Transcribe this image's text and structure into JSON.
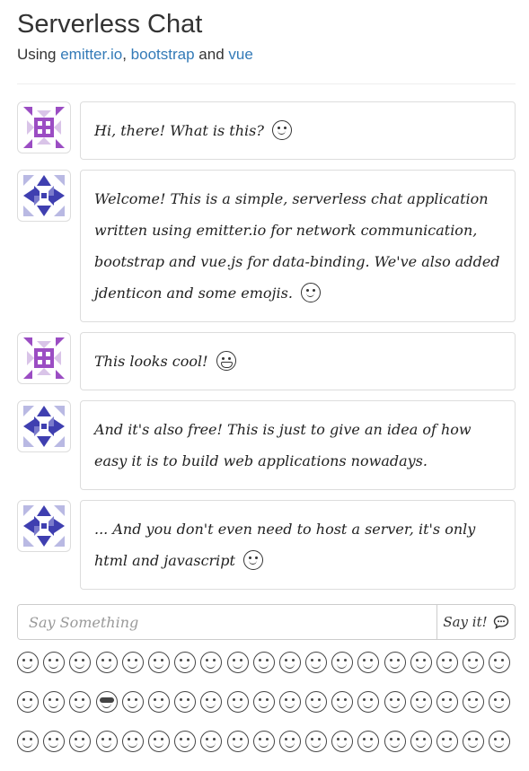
{
  "header": {
    "title": "Serverless Chat",
    "subtitle_prefix": "Using",
    "link1": "emitter.io",
    "sep1": ",",
    "link2": "bootstrap",
    "sep2": "and",
    "link3": "vue"
  },
  "messages": [
    {
      "avatar": "purple-identicon",
      "text": "Hi, there! What is this?",
      "emoji": "slightly-smiling-face"
    },
    {
      "avatar": "blue-identicon",
      "text": "Welcome! This is a simple, serverless chat application written using emitter.io for network communication, bootstrap and vue.js for data-binding. We've also added jdenticon and some emojis.",
      "emoji": "smiling-face"
    },
    {
      "avatar": "purple-identicon",
      "text": "This looks cool!",
      "emoji": "grimacing-face"
    },
    {
      "avatar": "blue-identicon",
      "text": "And it's also free! This is just to give an idea of how easy it is to build web applications nowadays.",
      "emoji": ""
    },
    {
      "avatar": "blue-identicon",
      "text": "... And you don't even need to host a server, it's only html and javascript",
      "emoji": "smiling-face"
    }
  ],
  "composer": {
    "placeholder": "Say Something",
    "send_label": "Say it!",
    "send_icon": "speech-bubble-icon"
  },
  "emoji_picker": {
    "rows": 3,
    "per_row": 19,
    "cool_index": 22
  },
  "colors": {
    "link": "#337ab7",
    "purple_identicon": "#9b4dc3",
    "blue_identicon": "#3f3fb0"
  }
}
